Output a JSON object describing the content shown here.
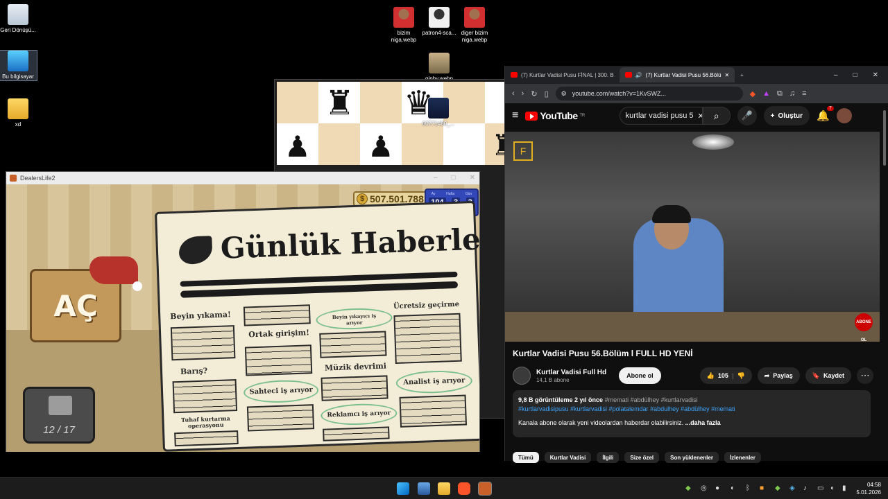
{
  "desktop": {
    "icons": [
      {
        "label": "Geri Dönüşü..."
      },
      {
        "label": "Bu bilgisayar"
      },
      {
        "label": "xd"
      },
      {
        "label": "bizim niga.webp"
      },
      {
        "label": "patron4-sca..."
      },
      {
        "label": "diger bizim niga.webp"
      },
      {
        "label": "giphy.webp"
      },
      {
        "label": "60771480_..."
      }
    ]
  },
  "chess": {
    "pieces": [
      "♜",
      "♛",
      "♟",
      "♟",
      "♜"
    ]
  },
  "game": {
    "window_title": "DealersLife2",
    "money": "507.501.788",
    "currency_symbol": "$",
    "calendar": {
      "headers": [
        "Ay",
        "Hafta",
        "Gün"
      ],
      "values": [
        "104",
        "3",
        "3"
      ]
    },
    "open_sign": "AÇ",
    "counter": "12 / 17",
    "newspaper": {
      "masthead": "Günlük Haberler",
      "headlines": [
        "Beyin yıkama!",
        "Ortak girişim!",
        "Beyin yıkayıcı iş arıyor",
        "Ücretsiz geçirme",
        "Barış?",
        "Müzik devrimi",
        "Sahteci iş arıyor",
        "Analist iş arıyor",
        "Tuhaf kurtarma operasyonu",
        "Reklamcı iş arıyor"
      ]
    }
  },
  "browser": {
    "tabs": [
      {
        "title": "(7) Kurtlar Vadisi Pusu FİNAL | 300. B"
      },
      {
        "title": "(7) Kurtlar Vadisi Pusu 56.Bölü"
      }
    ],
    "new_tab": "+",
    "url": "youtube.com/watch?v=1KvSWZ...",
    "youtube": {
      "logo": "YouTube",
      "region": "TR",
      "search_value": "kurtlar vadisi pusu 5",
      "create_label": "Oluştur",
      "notif_count": "7",
      "video_watermark": "F",
      "channel_badge": "ABONE OL",
      "video_title": "Kurtlar Vadisi Pusu 56.Bölüm l FULL HD YENİ",
      "channel_name": "Kurtlar Vadisi Full Hd",
      "subscribers": "14,1 B abone",
      "subscribe_label": "Abone ol",
      "likes": "105",
      "share_label": "Paylaş",
      "save_label": "Kaydet",
      "views": "9,8 B görüntüleme",
      "age": "2 yıl önce",
      "hashtags_top": "#memati #abdülhey #kurtlarvadisi",
      "hashtags": "#kurtlarvadisipusu #kurtlarvadisi #polatalemdar #abdulhey #abdülhey #memati",
      "description": "Kanala abone olarak yeni videolardan haberdar olabilirsiniz.",
      "more": "...daha fazla",
      "chips": [
        "Tümü",
        "Kurtlar Vadisi",
        "İlgili",
        "Size özel",
        "Son yüklenenler",
        "İzlenenler"
      ]
    }
  },
  "taskbar": {
    "time": "04:58",
    "date": "5.01.2026"
  },
  "colors": {
    "youtube_red": "#ff0000",
    "link_blue": "#3ea6ff",
    "taskbar": "#1c1c1c"
  }
}
